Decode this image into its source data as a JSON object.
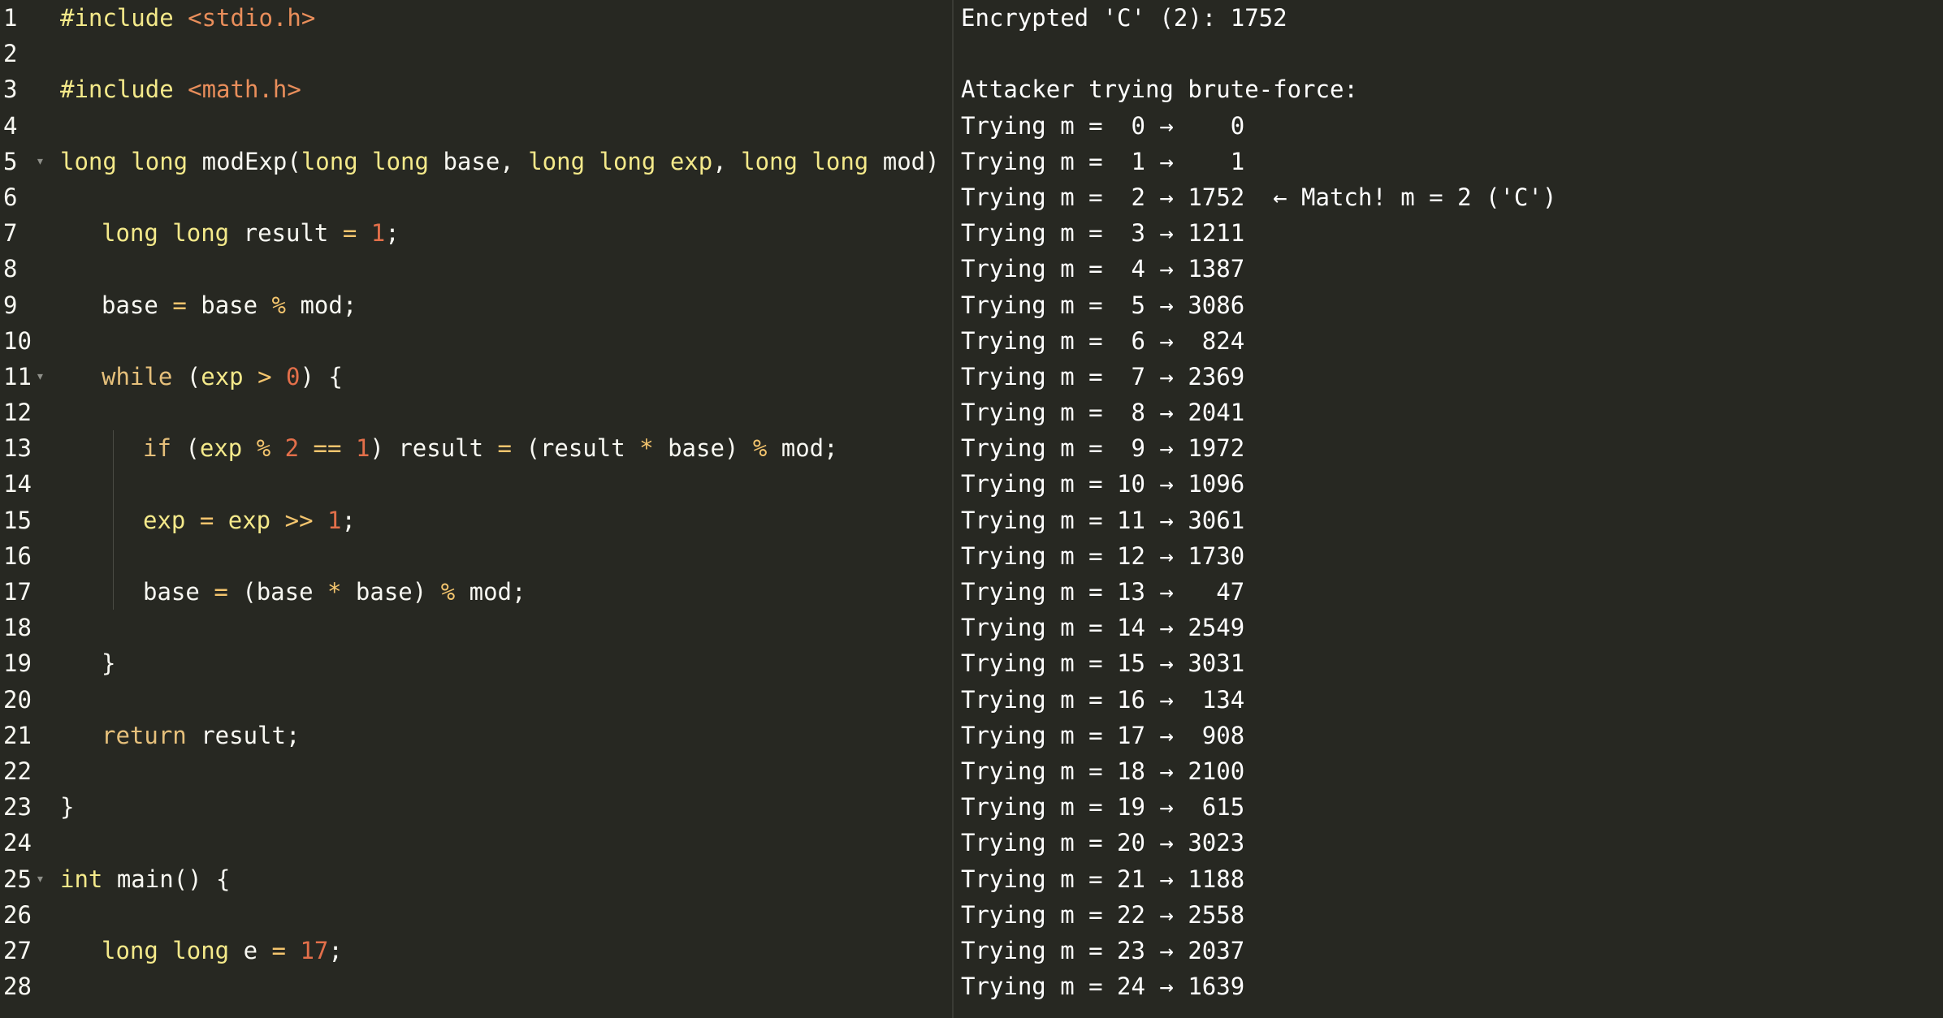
{
  "editor": {
    "lines": [
      {
        "n": "1",
        "fold": false,
        "indent": 0,
        "guide": false,
        "tokens": [
          {
            "t": "#include ",
            "c": "kw"
          },
          {
            "t": "<stdio.h>",
            "c": "str"
          }
        ]
      },
      {
        "n": "2",
        "fold": false,
        "indent": 0,
        "guide": false,
        "tokens": []
      },
      {
        "n": "3",
        "fold": false,
        "indent": 0,
        "guide": false,
        "tokens": [
          {
            "t": "#include ",
            "c": "kw"
          },
          {
            "t": "<math.h>",
            "c": "str"
          }
        ]
      },
      {
        "n": "4",
        "fold": false,
        "indent": 0,
        "guide": false,
        "tokens": []
      },
      {
        "n": "5",
        "fold": true,
        "indent": 0,
        "guide": false,
        "tokens": [
          {
            "t": "long long ",
            "c": "kw"
          },
          {
            "t": "modExp(",
            "c": "ptxt"
          },
          {
            "t": "long long ",
            "c": "kw"
          },
          {
            "t": "base, ",
            "c": "ptxt"
          },
          {
            "t": "long long ",
            "c": "kw"
          },
          {
            "t": "exp",
            "c": "kw"
          },
          {
            "t": ", ",
            "c": "ptxt"
          },
          {
            "t": "long long ",
            "c": "kw"
          },
          {
            "t": "mod) {",
            "c": "ptxt"
          }
        ]
      },
      {
        "n": "6",
        "fold": false,
        "indent": 0,
        "guide": false,
        "tokens": []
      },
      {
        "n": "7",
        "fold": false,
        "indent": 1,
        "guide": false,
        "tokens": [
          {
            "t": "long long ",
            "c": "kw"
          },
          {
            "t": "result ",
            "c": "ptxt"
          },
          {
            "t": "= ",
            "c": "op"
          },
          {
            "t": "1",
            "c": "num-lit"
          },
          {
            "t": ";",
            "c": "ptxt"
          }
        ]
      },
      {
        "n": "8",
        "fold": false,
        "indent": 0,
        "guide": false,
        "tokens": []
      },
      {
        "n": "9",
        "fold": false,
        "indent": 1,
        "guide": false,
        "tokens": [
          {
            "t": "base ",
            "c": "ptxt"
          },
          {
            "t": "= ",
            "c": "op"
          },
          {
            "t": "base ",
            "c": "ptxt"
          },
          {
            "t": "% ",
            "c": "op"
          },
          {
            "t": "mod;",
            "c": "ptxt"
          }
        ]
      },
      {
        "n": "10",
        "fold": false,
        "indent": 0,
        "guide": false,
        "tokens": []
      },
      {
        "n": "11",
        "fold": true,
        "indent": 1,
        "guide": false,
        "tokens": [
          {
            "t": "while ",
            "c": "ctl"
          },
          {
            "t": "(",
            "c": "ptxt"
          },
          {
            "t": "exp ",
            "c": "kw"
          },
          {
            "t": "> ",
            "c": "op"
          },
          {
            "t": "0",
            "c": "num-lit"
          },
          {
            "t": ") {",
            "c": "ptxt"
          }
        ]
      },
      {
        "n": "12",
        "fold": false,
        "indent": 0,
        "guide": false,
        "tokens": []
      },
      {
        "n": "13",
        "fold": false,
        "indent": 2,
        "guide": true,
        "tokens": [
          {
            "t": "if ",
            "c": "ctl"
          },
          {
            "t": "(",
            "c": "ptxt"
          },
          {
            "t": "exp ",
            "c": "kw"
          },
          {
            "t": "% ",
            "c": "op"
          },
          {
            "t": "2 ",
            "c": "num-lit"
          },
          {
            "t": "== ",
            "c": "op"
          },
          {
            "t": "1",
            "c": "num-lit"
          },
          {
            "t": ") result ",
            "c": "ptxt"
          },
          {
            "t": "= ",
            "c": "op"
          },
          {
            "t": "(result ",
            "c": "ptxt"
          },
          {
            "t": "* ",
            "c": "op"
          },
          {
            "t": "base) ",
            "c": "ptxt"
          },
          {
            "t": "% ",
            "c": "op"
          },
          {
            "t": "mod;",
            "c": "ptxt"
          }
        ]
      },
      {
        "n": "14",
        "fold": false,
        "indent": 0,
        "guide": true,
        "tokens": []
      },
      {
        "n": "15",
        "fold": false,
        "indent": 2,
        "guide": true,
        "tokens": [
          {
            "t": "exp ",
            "c": "kw"
          },
          {
            "t": "= ",
            "c": "op"
          },
          {
            "t": "exp ",
            "c": "kw"
          },
          {
            "t": ">> ",
            "c": "op"
          },
          {
            "t": "1",
            "c": "num-lit"
          },
          {
            "t": ";",
            "c": "ptxt"
          }
        ]
      },
      {
        "n": "16",
        "fold": false,
        "indent": 0,
        "guide": true,
        "tokens": []
      },
      {
        "n": "17",
        "fold": false,
        "indent": 2,
        "guide": true,
        "tokens": [
          {
            "t": "base ",
            "c": "ptxt"
          },
          {
            "t": "= ",
            "c": "op"
          },
          {
            "t": "(base ",
            "c": "ptxt"
          },
          {
            "t": "* ",
            "c": "op"
          },
          {
            "t": "base) ",
            "c": "ptxt"
          },
          {
            "t": "% ",
            "c": "op"
          },
          {
            "t": "mod;",
            "c": "ptxt"
          }
        ]
      },
      {
        "n": "18",
        "fold": false,
        "indent": 0,
        "guide": false,
        "tokens": []
      },
      {
        "n": "19",
        "fold": false,
        "indent": 1,
        "guide": false,
        "tokens": [
          {
            "t": "}",
            "c": "ptxt"
          }
        ]
      },
      {
        "n": "20",
        "fold": false,
        "indent": 0,
        "guide": false,
        "tokens": []
      },
      {
        "n": "21",
        "fold": false,
        "indent": 1,
        "guide": false,
        "tokens": [
          {
            "t": "return ",
            "c": "ctl"
          },
          {
            "t": "result;",
            "c": "ptxt"
          }
        ]
      },
      {
        "n": "22",
        "fold": false,
        "indent": 0,
        "guide": false,
        "tokens": []
      },
      {
        "n": "23",
        "fold": false,
        "indent": 0,
        "guide": false,
        "tokens": [
          {
            "t": "}",
            "c": "ptxt"
          }
        ]
      },
      {
        "n": "24",
        "fold": false,
        "indent": 0,
        "guide": false,
        "tokens": []
      },
      {
        "n": "25",
        "fold": true,
        "indent": 0,
        "guide": false,
        "tokens": [
          {
            "t": "int ",
            "c": "kw"
          },
          {
            "t": "main() {",
            "c": "ptxt"
          }
        ]
      },
      {
        "n": "26",
        "fold": false,
        "indent": 0,
        "guide": false,
        "tokens": []
      },
      {
        "n": "27",
        "fold": false,
        "indent": 1,
        "guide": false,
        "tokens": [
          {
            "t": "long long ",
            "c": "kw"
          },
          {
            "t": "e ",
            "c": "ptxt"
          },
          {
            "t": "= ",
            "c": "op"
          },
          {
            "t": "17",
            "c": "num-lit"
          },
          {
            "t": ";",
            "c": "ptxt"
          }
        ]
      },
      {
        "n": "28",
        "fold": false,
        "indent": 0,
        "guide": false,
        "tokens": []
      }
    ]
  },
  "console": {
    "lines": [
      "Encrypted 'C' (2): 1752",
      "",
      "Attacker trying brute-force:",
      "Trying m =  0 →    0",
      "Trying m =  1 →    1",
      "Trying m =  2 → 1752  ← Match! m = 2 ('C')",
      "Trying m =  3 → 1211",
      "Trying m =  4 → 1387",
      "Trying m =  5 → 3086",
      "Trying m =  6 →  824",
      "Trying m =  7 → 2369",
      "Trying m =  8 → 2041",
      "Trying m =  9 → 1972",
      "Trying m = 10 → 1096",
      "Trying m = 11 → 3061",
      "Trying m = 12 → 1730",
      "Trying m = 13 →   47",
      "Trying m = 14 → 2549",
      "Trying m = 15 → 3031",
      "Trying m = 16 →  134",
      "Trying m = 17 →  908",
      "Trying m = 18 → 2100",
      "Trying m = 19 →  615",
      "Trying m = 20 → 3023",
      "Trying m = 21 → 1188",
      "Trying m = 22 → 2558",
      "Trying m = 23 → 2037",
      "Trying m = 24 → 1639"
    ]
  }
}
